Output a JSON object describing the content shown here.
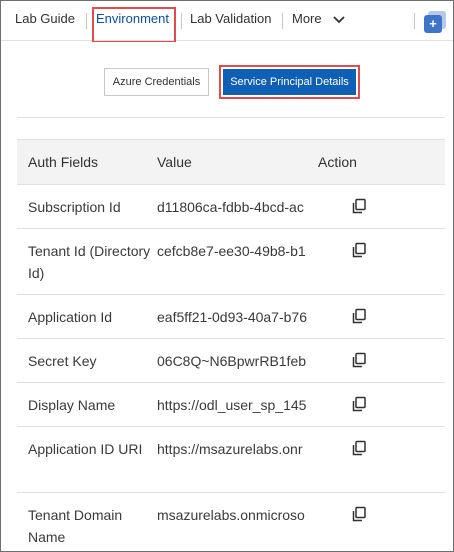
{
  "nav": {
    "tabs": [
      {
        "label": "Lab Guide"
      },
      {
        "label": "Environment"
      },
      {
        "label": "Lab Validation"
      },
      {
        "label": "More"
      }
    ]
  },
  "buttons": {
    "azure_credentials": "Azure Credentials",
    "service_principal_details": "Service Principal Details"
  },
  "table": {
    "headers": {
      "field": "Auth Fields",
      "value": "Value",
      "action": "Action"
    },
    "rows": [
      {
        "field": "Subscription Id",
        "value": "d11806ca-fdbb-4bcd-ac"
      },
      {
        "field": "Tenant Id (Directory Id)",
        "value": "cefcb8e7-ee30-49b8-b1"
      },
      {
        "field": "Application Id",
        "value": "eaf5ff21-0d93-40a7-b76"
      },
      {
        "field": "Secret Key",
        "value": "06C8Q~N6BpwrRB1feb"
      },
      {
        "field": "Display Name",
        "value": "https://odl_user_sp_145"
      },
      {
        "field": "Application ID URI",
        "value": "https://msazurelabs.onr"
      },
      {
        "field": "Tenant Domain Name",
        "value": "msazurelabs.onmicroso"
      }
    ]
  },
  "colors": {
    "accent": "#0f5fb5",
    "highlight": "#e04b4b",
    "active_tab": "#0f4c9c"
  }
}
